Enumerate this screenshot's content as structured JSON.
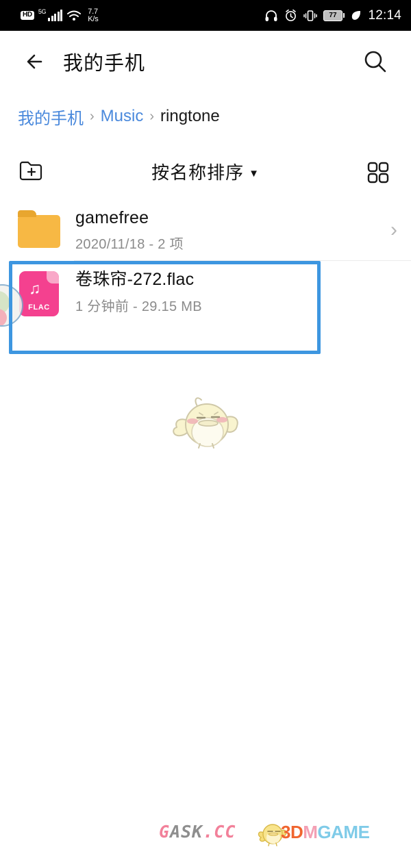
{
  "status_bar": {
    "hd_label": "HD",
    "network_label": "5G",
    "net_speed_value": "7.7",
    "net_speed_unit": "K/s",
    "wifi_icon": "wifi-icon",
    "headphone_icon": "headphone-icon",
    "alarm_icon": "alarm-clock-icon",
    "vibrate_icon": "vibrate-icon",
    "battery_level": "77",
    "eco_icon": "leaf-icon",
    "clock": "12:14",
    "background": "#000000"
  },
  "app_bar": {
    "back_icon": "back-arrow-icon",
    "title": "我的手机",
    "search_icon": "search-icon"
  },
  "breadcrumb": {
    "items": [
      {
        "label": "我的手机",
        "type": "link"
      },
      {
        "label": "Music",
        "type": "link"
      },
      {
        "label": "ringtone",
        "type": "current"
      }
    ],
    "separator": "›",
    "link_color": "#4a89dc"
  },
  "toolbar": {
    "new_folder_icon": "new-folder-icon",
    "sort_label": "按名称排序",
    "sort_caret": "▼",
    "grid_view_icon": "grid-view-icon"
  },
  "file_list": [
    {
      "name": "gamefree",
      "meta": "2020/11/18 - 2 项",
      "kind": "folder",
      "icon": "folder-icon",
      "chevron": "›",
      "selected": false
    },
    {
      "name": "卷珠帘-272.flac",
      "meta": "1 分钟前 - 29.15 MB",
      "kind": "file",
      "icon": "flac-file-icon",
      "extension": "FLAC",
      "note_glyph": "♫",
      "chevron": "",
      "selected": true
    }
  ],
  "highlight": {
    "color": "#3d96e0",
    "target": "卷珠帘-272.flac"
  },
  "mascot": {
    "name": "chick-mascot-illustration",
    "body_color": "#f7f3cf",
    "outline_color": "#cfc8a8",
    "cheek_color": "#f0b0b6"
  },
  "floating_ball": {
    "name": "floating-assistant-ball"
  },
  "watermarks": {
    "gask": {
      "part1": "G",
      "part2": "ASK",
      "part3": ".CC"
    },
    "tdm": {
      "p1": "3",
      "p2": "D",
      "p3": "M",
      "p4": "GAM",
      "p5": "E"
    },
    "chick_icon": "chick-logo-icon"
  }
}
